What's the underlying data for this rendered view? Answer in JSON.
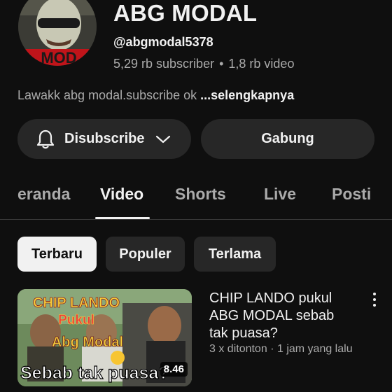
{
  "channel": {
    "name": "ABG MODAL",
    "handle": "@abgmodal5378",
    "subscribers": "5,29 rb subscriber",
    "separator": "•",
    "videos": "1,8 rb video",
    "avatar_text": "MOD",
    "description": "Lawakk abg modal.subscribe ok ",
    "description_more": "...selengkapnya"
  },
  "actions": {
    "subscribe_label": "Disubscribe",
    "join_label": "Gabung"
  },
  "tabs": [
    {
      "label": "eranda",
      "active": false
    },
    {
      "label": "Video",
      "active": true
    },
    {
      "label": "Shorts",
      "active": false
    },
    {
      "label": "Live",
      "active": false
    },
    {
      "label": "Posti",
      "active": false
    }
  ],
  "filters": [
    {
      "label": "Terbaru",
      "selected": true
    },
    {
      "label": "Populer",
      "selected": false
    },
    {
      "label": "Terlama",
      "selected": false
    }
  ],
  "video": {
    "title": "CHIP LANDO pukul ABG MODAL sebab tak puasa?",
    "views": "3 x ditonton",
    "dot": "·",
    "age": "1 jam yang lalu",
    "duration": "8.46",
    "thumb_text": {
      "line1": "CHIP LANDO",
      "line2": "Pukul",
      "line3": "Abg Modal",
      "line4": "Sebab tak puasa?"
    }
  },
  "icons": {
    "bell": "bell-icon",
    "chevron": "chevron-down-icon",
    "kebab": "more-vert-icon"
  },
  "colors": {
    "background": "#0f0f0f",
    "surface": "#272727",
    "text_primary": "#f1f1f1",
    "text_secondary": "#aaaaaa",
    "thumb_accent": "#f7d23b"
  }
}
